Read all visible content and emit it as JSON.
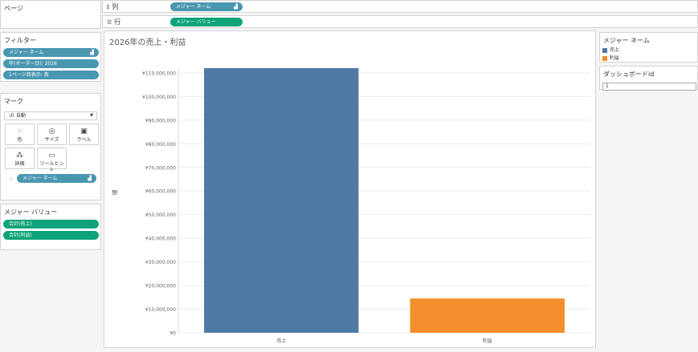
{
  "pages": {
    "title": "ページ"
  },
  "shelves": {
    "columns": {
      "label": "列",
      "icon": "columns-icon",
      "pill": "メジャー ネーム"
    },
    "rows": {
      "label": "行",
      "icon": "rows-icon",
      "pill": "メジャー バリュー"
    }
  },
  "filters": {
    "title": "フィルター",
    "items": [
      "メジャー ネーム",
      "年(オーダー日): 2026",
      "1ページ目表示: 真"
    ]
  },
  "marks": {
    "title": "マーク",
    "type": "自動",
    "buttons": [
      {
        "label": "色",
        "icon": "color-icon"
      },
      {
        "label": "サイズ",
        "icon": "size-icon"
      },
      {
        "label": "ラベル",
        "icon": "label-icon"
      },
      {
        "label": "詳細",
        "icon": "detail-icon"
      },
      {
        "label": "ツールヒント",
        "icon": "tooltip-icon"
      }
    ],
    "field": "メジャー ネーム"
  },
  "measure_values": {
    "title": "メジャー バリュー",
    "items": [
      "合計(売上)",
      "合計(利益)"
    ]
  },
  "legend": {
    "title": "メジャー ネーム",
    "items": [
      {
        "label": "売上",
        "color": "#4e79a7"
      },
      {
        "label": "利益",
        "color": "#f28e2b"
      }
    ]
  },
  "dashboard_param": {
    "title": "ダッシュボードid",
    "value": "1"
  },
  "chart_data": {
    "type": "bar",
    "title": "2026年の売上・利益",
    "ylabel": "値",
    "categories": [
      "売上",
      "利益"
    ],
    "values": [
      112000000,
      14500000
    ],
    "colors": [
      "#4e79a7",
      "#f28e2b"
    ],
    "ylim": [
      0,
      112000000
    ],
    "yticks": [
      0,
      10000000,
      20000000,
      30000000,
      40000000,
      50000000,
      60000000,
      70000000,
      80000000,
      90000000,
      100000000,
      110000000
    ],
    "ytick_labels": [
      "¥0",
      "¥10,000,000",
      "¥20,000,000",
      "¥30,000,000",
      "¥40,000,000",
      "¥50,000,000",
      "¥60,000,000",
      "¥70,000,000",
      "¥80,000,000",
      "¥90,000,000",
      "¥100,000,000",
      "¥110,000,000"
    ],
    "grid": true
  }
}
